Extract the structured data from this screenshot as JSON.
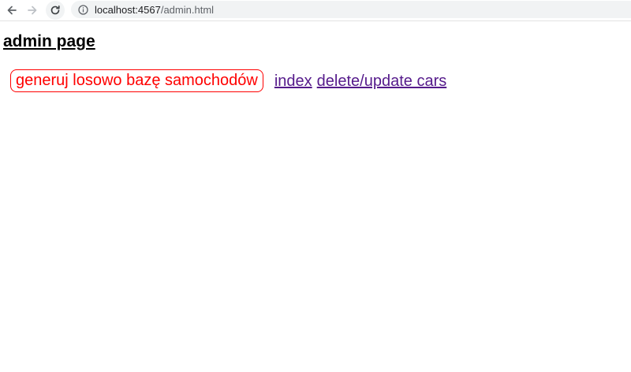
{
  "browser": {
    "url_host": "localhost:4567",
    "url_path": "/admin.html",
    "icons": {
      "back": "arrow-left-icon",
      "forward": "arrow-right-icon",
      "reload": "reload-icon",
      "site_info": "info-icon"
    }
  },
  "page": {
    "title": "admin page",
    "generate_button_label": "generuj losowo bazę samochodów",
    "links": {
      "index": "index",
      "delete_update": "delete/update cars"
    }
  },
  "colors": {
    "button_accent": "#ff0000",
    "visited_link": "#551a8b",
    "address_bar_bg": "#f1f3f4"
  }
}
